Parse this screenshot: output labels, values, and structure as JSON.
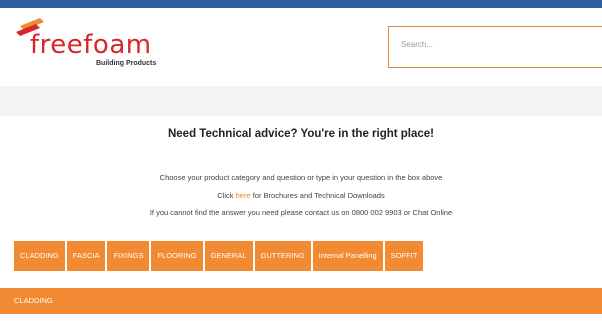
{
  "brand": {
    "logo_word_part1": "free",
    "logo_word_part2": "foam",
    "logo_tagline": "Building Products",
    "primary_color": "#d9262a",
    "accent_color": "#f18a32"
  },
  "search": {
    "placeholder": "Search..."
  },
  "content": {
    "headline": "Need Technical advice? You're in the right place!",
    "line1": "Choose your product category and question or type in your question in the box above",
    "line2_prefix": "Click ",
    "line2_link": "here",
    "line2_suffix": " for Brochures and Technical Downloads",
    "line3": "If you cannot find the answer you need please contact us on 0800 002 9903 or Chat Online"
  },
  "tabs": [
    "CLADDING",
    "FASCIA",
    "FIXINGS",
    "FLOORING",
    "GENERAL",
    "GUTTERING",
    "Internal Panelling",
    "SOFFIT"
  ],
  "section": {
    "title": "CLADDING"
  }
}
